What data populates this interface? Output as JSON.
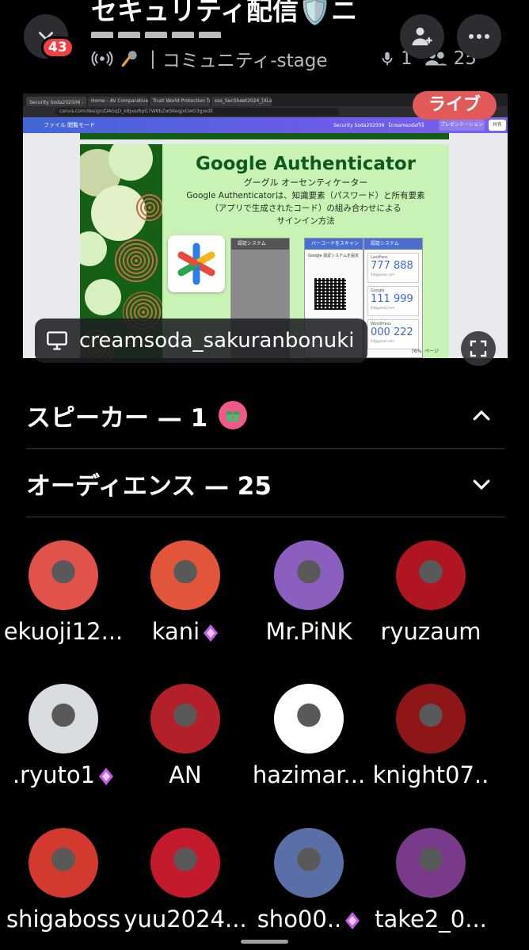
{
  "header": {
    "badge_count": "43",
    "title": "セキュリティ配信🛡️ニ",
    "channel": "コミュニティ-stage",
    "separator": "|",
    "speaker_count": "1",
    "listener_count": "25",
    "icons": [
      "chevron-down-icon",
      "add-person-icon",
      "more-icon",
      "stage-icon",
      "microphone-icon"
    ]
  },
  "stream": {
    "live_label": "ライブ",
    "streamer": "creamsoda_sakuranbonuki",
    "browser_tabs": [
      "Security Soda202506 - プレゼン",
      "Home - AV Comparatives",
      "Trust World Protection Test Fifo Mar",
      "ess_SecSheet2024_[XLsx]"
    ],
    "url": "canva.com/design/DAGqD_kBJxo/6pG7W8bZwSKeqjxOwO3g/edit",
    "canva_file": "ファイル",
    "canva_mode": "閲覧モード",
    "canva_doc": "Security Soda202506 【creamsoda作】",
    "canva_present": "プレゼンテーション",
    "canva_share": "共有",
    "slide": {
      "title": "Google Authenticator",
      "ruby": "グーグル オーセンティケーター",
      "description": [
        "Google Authenticatorは、知識要素（パスワード）と所有要素",
        "（アプリで生成されたコード）の組み合わせによる",
        "サインイン方法"
      ],
      "phone1_header": "認証システム",
      "phone2_header": "バーコードをスキャン",
      "phone2_caption": "Google 認証システムを設定",
      "phone3_header": "認証システム",
      "codes": [
        {
          "service": "LastPass",
          "code": "777 888",
          "account": "lhf@gmail.com"
        },
        {
          "service": "Google",
          "code": "111 999",
          "account": "lhf@gmail.com"
        },
        {
          "service": "WordPress",
          "code": "000 222",
          "account": "lhf@gmail.com"
        }
      ],
      "zoom": "76%",
      "page": "ページ"
    }
  },
  "sections": {
    "speakers_label": "スピーカー — 1",
    "audience_label": "オーディエンス — 25"
  },
  "audience": [
    {
      "name": "ekuoji12...",
      "gem": false,
      "color": "#e0524b"
    },
    {
      "name": "kani",
      "gem": true,
      "color": "#e2553a"
    },
    {
      "name": "Mr.PiNK",
      "gem": false,
      "color": "#8b5fbf"
    },
    {
      "name": "ryuzaum",
      "gem": false,
      "color": "#b01622"
    },
    {
      "name": ".ryuto1",
      "gem": true,
      "color": "#d9dde2"
    },
    {
      "name": "AN",
      "gem": false,
      "color": "#b3202a"
    },
    {
      "name": "hazimar...",
      "gem": false,
      "color": "#ffffff"
    },
    {
      "name": "knight07..",
      "gem": false,
      "color": "#8f1616"
    },
    {
      "name": "shigaboss",
      "gem": false,
      "color": "#d23a2f"
    },
    {
      "name": "yuu2024...",
      "gem": false,
      "color": "#c31b2c"
    },
    {
      "name": "sho00..",
      "gem": true,
      "color": "#5a6fa8"
    },
    {
      "name": "take2_0...",
      "gem": false,
      "color": "#7a3a8a"
    }
  ]
}
